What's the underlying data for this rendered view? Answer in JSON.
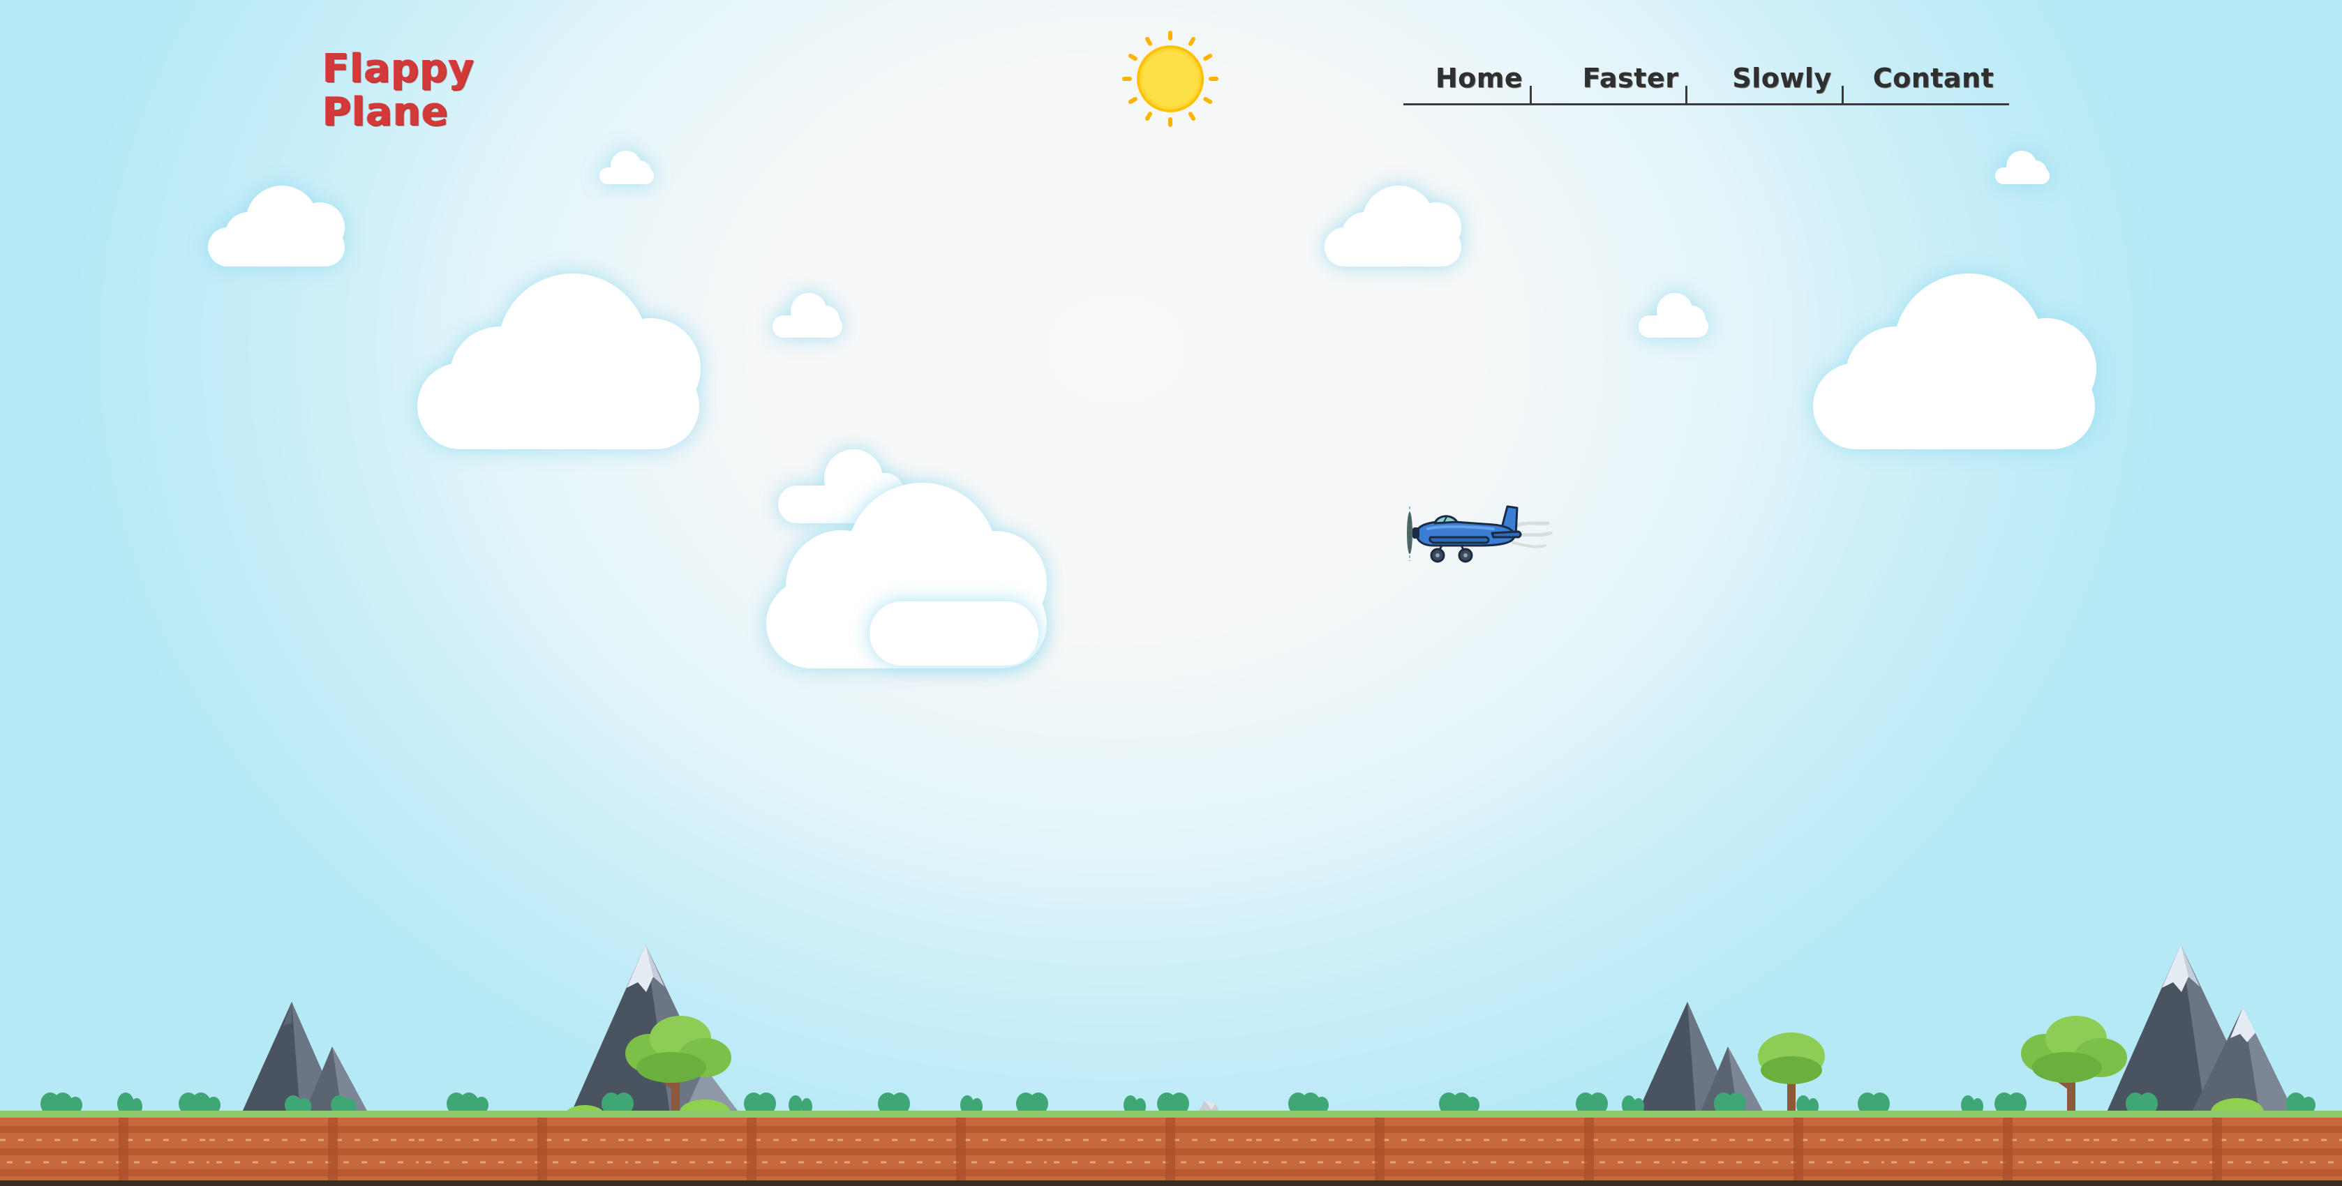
{
  "logo": {
    "line1": "Flappy",
    "line2": "Plane"
  },
  "nav": {
    "items": [
      {
        "label": "Home",
        "name": "nav-home"
      },
      {
        "label": "Faster",
        "name": "nav-faster"
      },
      {
        "label": "Slowly",
        "name": "nav-slowly"
      },
      {
        "label": "Contant",
        "name": "nav-contant"
      }
    ]
  },
  "colors": {
    "logo": "#d23a3a",
    "nav_text": "#2f2f2f",
    "sun": "#fdd835",
    "sun_rays": "#ffb300",
    "plane": "#3a7fd5",
    "ground": "#c8693d",
    "grass": "#8fc96d",
    "sky_center": "#f9f9f9",
    "sky_edge": "#b6e9f6"
  },
  "icons": {
    "sun": "sun-icon",
    "plane": "player-plane-icon",
    "cloud": "cloud-icon",
    "mountain": "mountain-icon",
    "tree": "tree-icon",
    "bush": "bush-icon"
  }
}
